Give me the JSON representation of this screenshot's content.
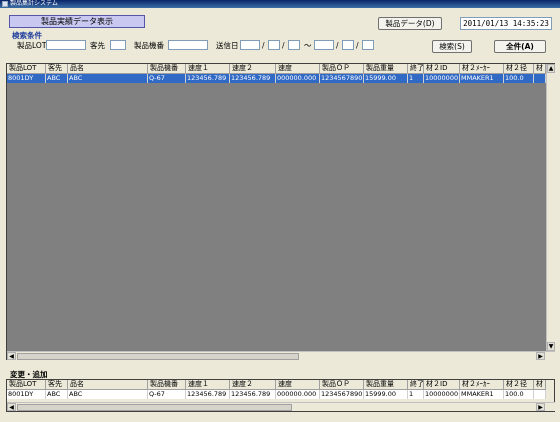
{
  "window": {
    "title": "製品集計システム"
  },
  "header": {
    "view_button": "製品実績データ表示",
    "data_button": "製品データ(D)",
    "datetime": "2011/01/13 14:35:23"
  },
  "search": {
    "section_title": "検索条件",
    "lot_label": "製品LOT",
    "customer_label": "客先",
    "model_label": "製品機番",
    "send_date_label": "送信日",
    "slash": "/",
    "tilde": "～",
    "search_button": "検索(S)",
    "all_button": "全件(A)"
  },
  "main_grid": {
    "columns": [
      "製品LOT",
      "客先",
      "品名",
      "製品機番",
      "速度１",
      "速度２",
      "速度",
      "製品ＯＰ",
      "製品重量",
      "終了",
      "材２ID",
      "材２ﾒｰｶｰ",
      "材２径",
      "材"
    ],
    "rows": [
      [
        "8001DY",
        "ABC",
        "ABC",
        "Q-67",
        "123456.789",
        "123456.789",
        "000000.000",
        "1234567890",
        "15999.00",
        "1",
        "10000000",
        "MMAKER1",
        "100.0",
        ""
      ]
    ]
  },
  "edit_section": {
    "title": "変更・追加",
    "columns": [
      "製品LOT",
      "客先",
      "品名",
      "製品機番",
      "速度１",
      "速度２",
      "速度",
      "製品ＯＰ",
      "製品重量",
      "終了",
      "材２ID",
      "材２ﾒｰｶｰ",
      "材２径",
      "材"
    ],
    "rows": [
      [
        "8001DY",
        "ABC",
        "ABC",
        "Q-67",
        "123456.789",
        "123456.789",
        "000000.000",
        "1234567890",
        "15999.00",
        "1",
        "10000000",
        "MMAKER1",
        "100.0",
        ""
      ]
    ]
  }
}
